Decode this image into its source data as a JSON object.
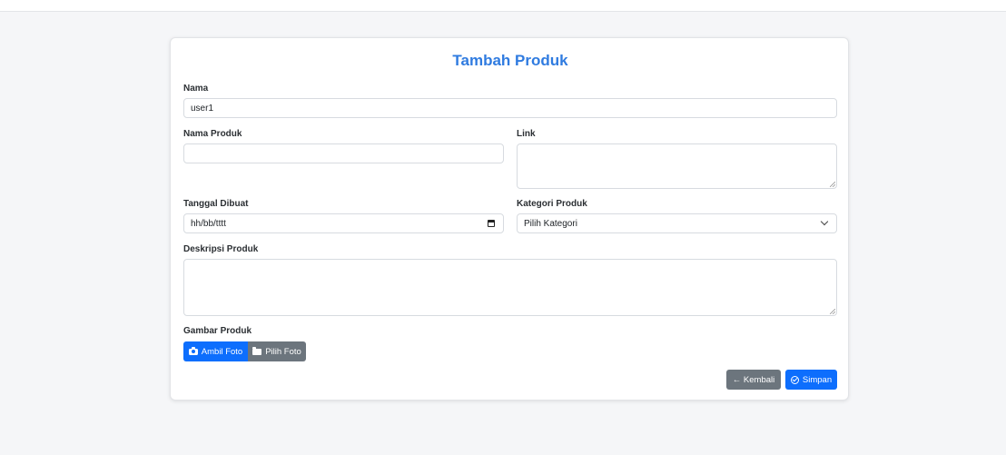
{
  "page": {
    "title": "Tambah Produk"
  },
  "form": {
    "nama": {
      "label": "Nama",
      "value": "user1"
    },
    "nama_produk": {
      "label": "Nama Produk",
      "value": ""
    },
    "link": {
      "label": "Link",
      "value": ""
    },
    "tanggal_dibuat": {
      "label": "Tanggal Dibuat",
      "placeholder": "hh/bb/tttt"
    },
    "kategori_produk": {
      "label": "Kategori Produk",
      "selected": "Pilih Kategori"
    },
    "deskripsi_produk": {
      "label": "Deskripsi Produk",
      "value": ""
    },
    "gambar_produk": {
      "label": "Gambar Produk",
      "take_photo_label": "Ambil Foto",
      "choose_photo_label": "Pilih Foto"
    }
  },
  "actions": {
    "back_label": "← Kembali",
    "save_label": "Simpan"
  },
  "colors": {
    "title": "#2f7be0",
    "primary": "#0d6efd",
    "secondary": "#6c757d",
    "background": "#f5f6f8"
  },
  "icons": {
    "calendar": "calendar-icon",
    "chevron": "chevron-down-icon",
    "camera": "camera-icon",
    "folder": "folder-icon",
    "save": "check-circle-icon"
  }
}
